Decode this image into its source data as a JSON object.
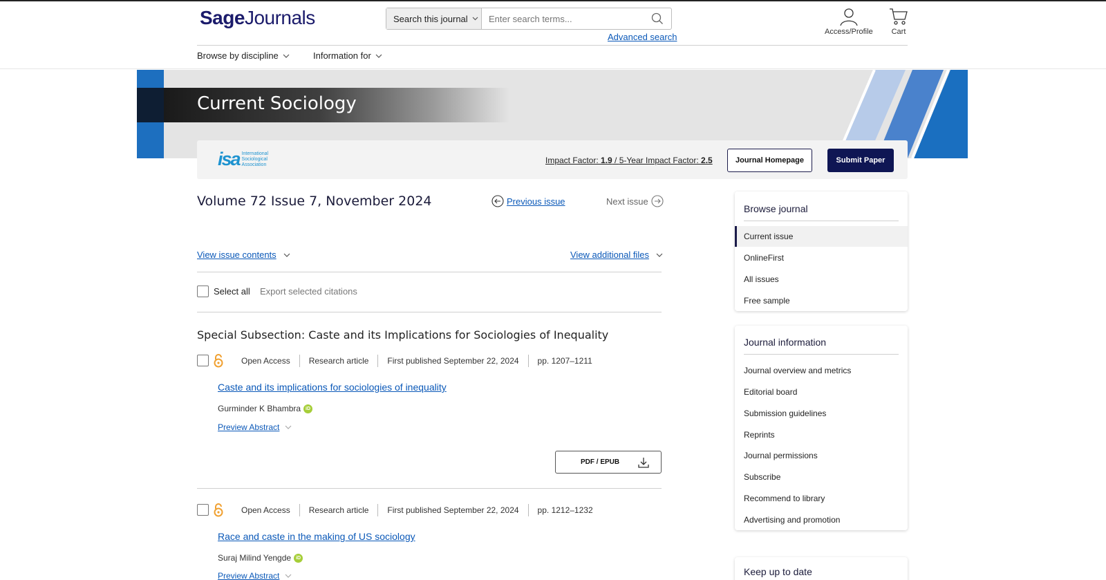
{
  "header": {
    "logo_sage": "Sage",
    "logo_journals": "Journals",
    "search_scope": "Search this journal",
    "search_placeholder": "Enter search terms...",
    "advanced_search": "Advanced search",
    "access_profile": "Access/Profile",
    "cart": "Cart",
    "nav": [
      {
        "label": "Browse by discipline"
      },
      {
        "label": "Information for"
      }
    ]
  },
  "banner": {
    "journal_title": "Current Sociology"
  },
  "infobar": {
    "isa_mark": "isa",
    "isa_line1": "International",
    "isa_line2": "Sociological",
    "isa_line3": "Association",
    "impact_label": "Impact Factor: ",
    "impact_value": "1.9",
    "impact_sep": " / ",
    "five_year_label": "5-Year Impact Factor: ",
    "five_year_value": "2.5",
    "journal_homepage": "Journal Homepage",
    "submit_paper": "Submit Paper"
  },
  "issue": {
    "title": "Volume 72 Issue 7, November 2024",
    "previous": "Previous issue",
    "next": "Next issue",
    "view_contents": "View issue contents",
    "view_files": "View additional files",
    "select_all": "Select all",
    "export": "Export selected citations",
    "section_heading": "Special Subsection: Caste and its Implications for Sociologies of Inequality"
  },
  "articles": [
    {
      "access": "Open Access",
      "type": "Research article",
      "published": "First published September 22, 2024",
      "pages": "pp. 1207–1211",
      "title": "Caste and its implications for sociologies of inequality",
      "author": "Gurminder K Bhambra",
      "preview": "Preview Abstract",
      "pdf": "PDF / EPUB"
    },
    {
      "access": "Open Access",
      "type": "Research article",
      "published": "First published September 22, 2024",
      "pages": "pp. 1212–1232",
      "title": "Race and caste in the making of US sociology",
      "author": "Suraj Milind Yengde",
      "preview": "Preview Abstract"
    }
  ],
  "sidebar": {
    "browse_title": "Browse journal",
    "browse_items": [
      {
        "label": "Current issue"
      },
      {
        "label": "OnlineFirst"
      },
      {
        "label": "All issues"
      },
      {
        "label": "Free sample"
      }
    ],
    "info_title": "Journal information",
    "info_items": [
      {
        "label": "Journal overview and metrics"
      },
      {
        "label": "Editorial board"
      },
      {
        "label": "Submission guidelines"
      },
      {
        "label": "Reprints"
      },
      {
        "label": "Journal permissions"
      },
      {
        "label": "Subscribe"
      },
      {
        "label": "Recommend to library"
      },
      {
        "label": "Advertising and promotion"
      }
    ],
    "keep_title": "Keep up to date"
  },
  "colors": {
    "brand_navy": "#0f1654",
    "link_blue": "#0a58b8",
    "banner_blue": "#1d6fbf",
    "open_access_orange": "#f0a030",
    "orcid_green": "#a6ce39"
  },
  "icons": [
    "search-icon",
    "user-icon",
    "cart-icon",
    "chevron-down-icon",
    "arrow-left-circle-icon",
    "arrow-right-circle-icon",
    "open-access-icon",
    "orcid-icon",
    "download-icon"
  ]
}
